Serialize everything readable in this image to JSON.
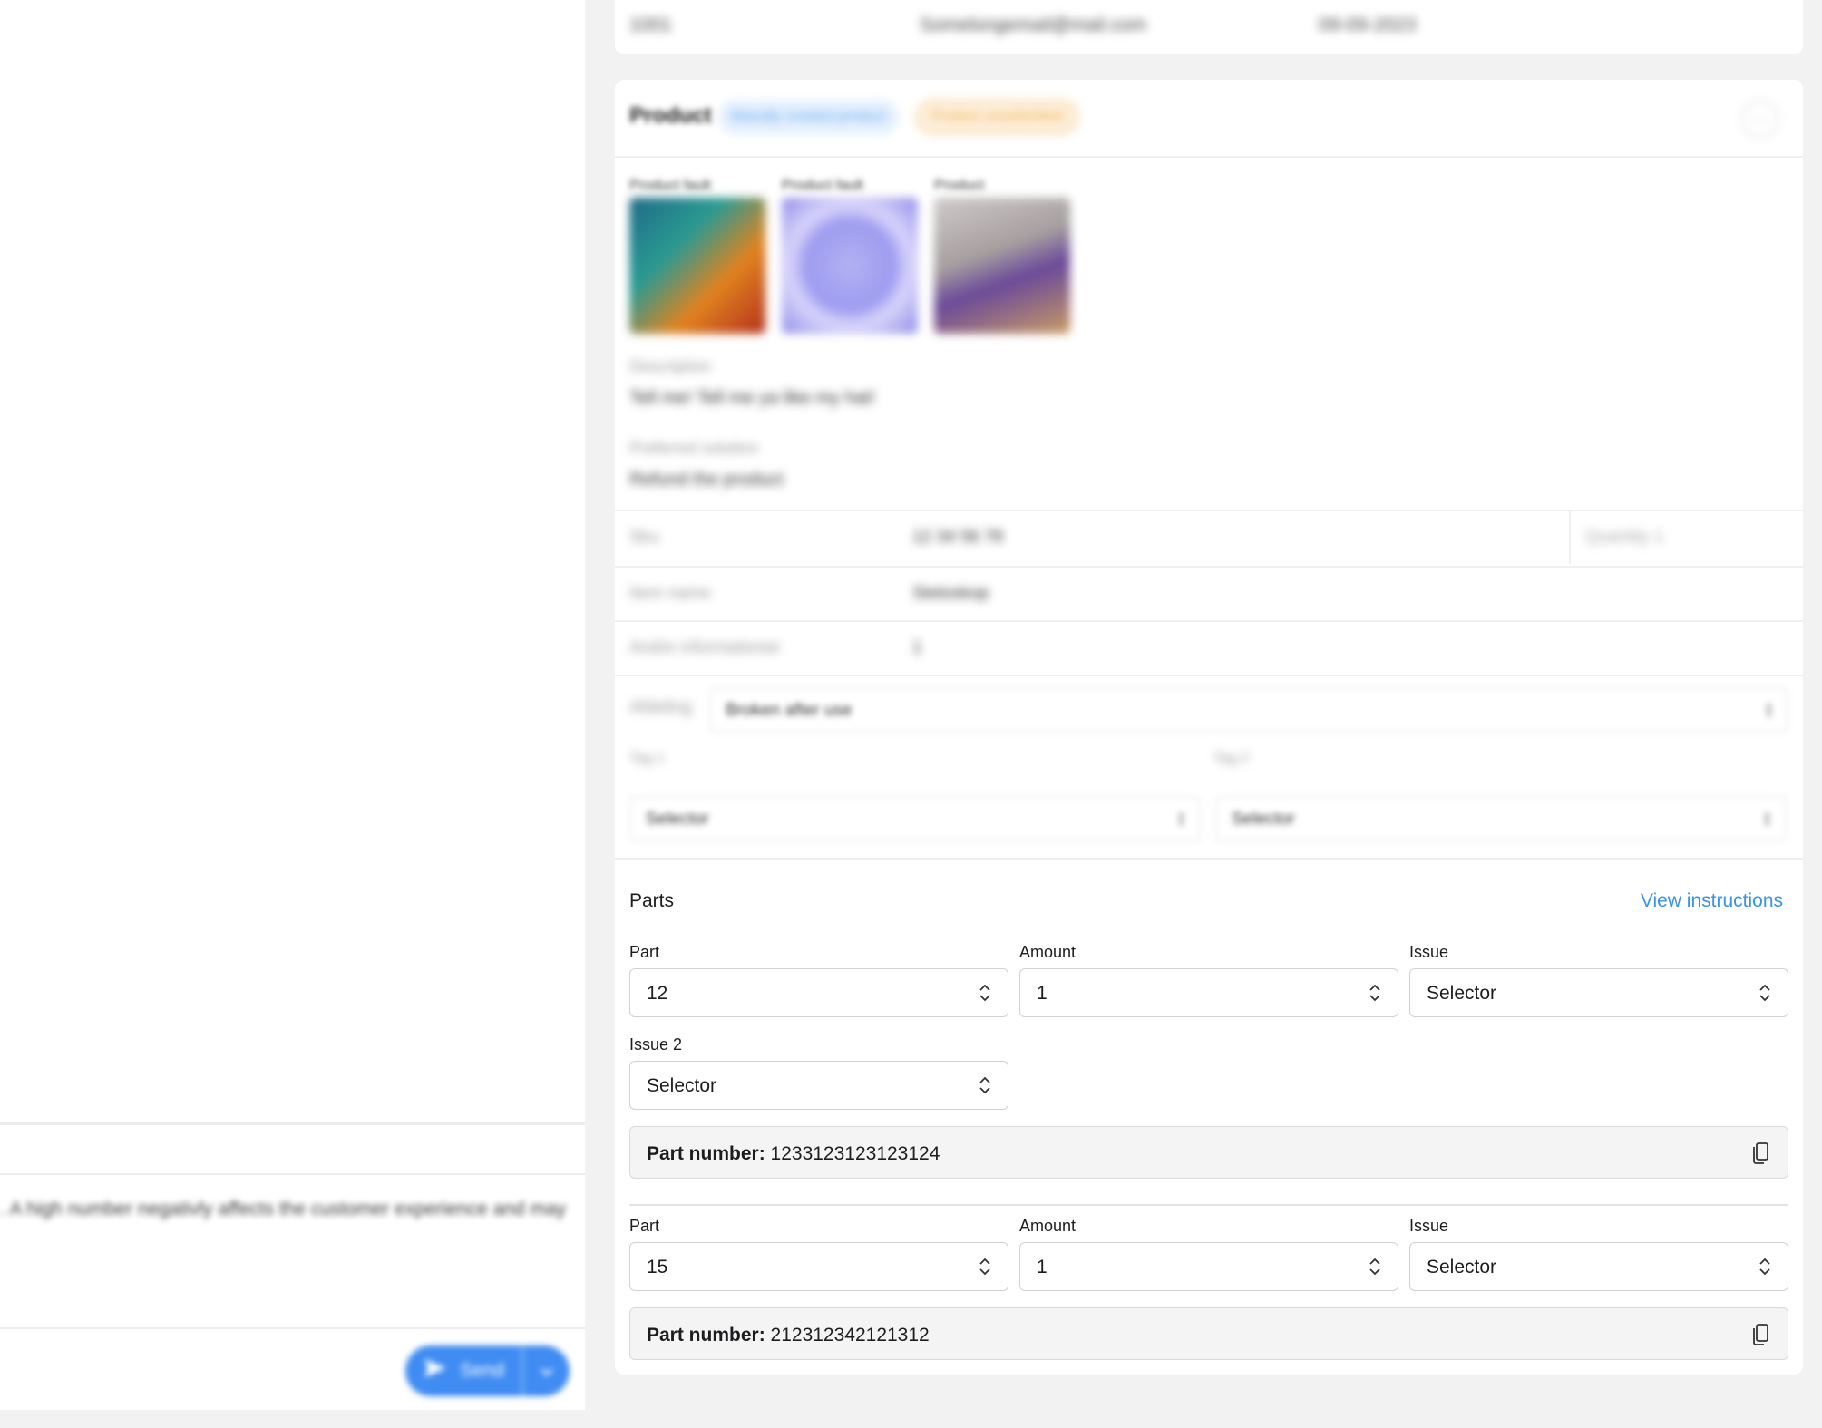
{
  "left_pane": {
    "hint_text": ". A high number negativly affects the customer experience and may",
    "send_label": "Send"
  },
  "order": {
    "number": "1001",
    "email": "Somelongemail@mail.com",
    "date": "09-09-2023"
  },
  "product": {
    "title": "Product",
    "badge_manual": "Manully created product",
    "badge_status": "Product unsubmitted",
    "images": [
      {
        "label": "Product fault"
      },
      {
        "label": "Product fault"
      },
      {
        "label": "Product"
      }
    ],
    "description_label": "Description",
    "description_value": "Tell me! Tell me ya like my hat!",
    "solution_label": "Preferred solution",
    "solution_value": "Refund the product",
    "sku_label": "Sku",
    "sku_value": "12 34 56 78",
    "quantity": "Quantity 1",
    "item_name_label": "Item name",
    "item_name_value": "Stetoskop",
    "other_info_label": "Andre informationer",
    "other_info_value": "1",
    "department_label": "Afdeling",
    "department_value": "Broken after use",
    "tag1_label": "Tag 1",
    "tag1_value": "Selector",
    "tag2_label": "Tag 2",
    "tag2_value": "Selector"
  },
  "parts": {
    "title": "Parts",
    "view_instructions": "View instructions",
    "items": [
      {
        "part_label": "Part",
        "part_value": "12",
        "amount_label": "Amount",
        "amount_value": "1",
        "issue_label": "Issue",
        "issue_value": "Selector",
        "issue2_label": "Issue 2",
        "issue2_value": "Selector",
        "partnumber_label": "Part number:",
        "partnumber_value": "1233123123123124"
      },
      {
        "part_label": "Part",
        "part_value": "15",
        "amount_label": "Amount",
        "amount_value": "1",
        "issue_label": "Issue",
        "issue_value": "Selector",
        "partnumber_label": "Part number:",
        "partnumber_value": "212312342121312"
      }
    ]
  },
  "colors": {
    "accent": "#3b93e6",
    "send_button": "#3f8cf2",
    "badge_blue_bg": "#e4f0fd",
    "badge_orange_bg": "#fdf0dc"
  }
}
